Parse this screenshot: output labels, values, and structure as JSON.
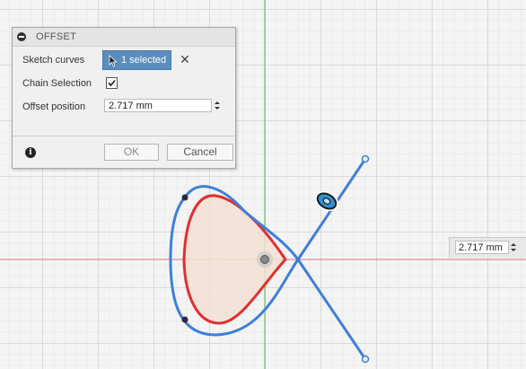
{
  "dialog": {
    "title": "OFFSET",
    "sketch_curves_label": "Sketch curves",
    "selection_button_label": "1 selected",
    "chain_selection_label": "Chain Selection",
    "chain_selection_checked": true,
    "offset_position_label": "Offset position",
    "offset_position_value": "2.717 mm",
    "ok_label": "OK",
    "cancel_label": "Cancel"
  },
  "canvas": {
    "dimension_value": "2.717 mm"
  },
  "colors": {
    "selected_curve": "#3d7fd9",
    "offset_curve": "#e03030",
    "profile_fill": "#f2dfd2",
    "x_axis": "#e07070",
    "y_axis": "#4fc04f",
    "selection_button": "#5a8dbd"
  },
  "icons": {
    "collapse": "collapse-icon",
    "cursor": "cursor-icon",
    "clear": "close-icon",
    "check": "check-icon",
    "info": "info-icon",
    "origin": "origin-icon",
    "offset_manipulator": "offset-manipulator-icon"
  }
}
